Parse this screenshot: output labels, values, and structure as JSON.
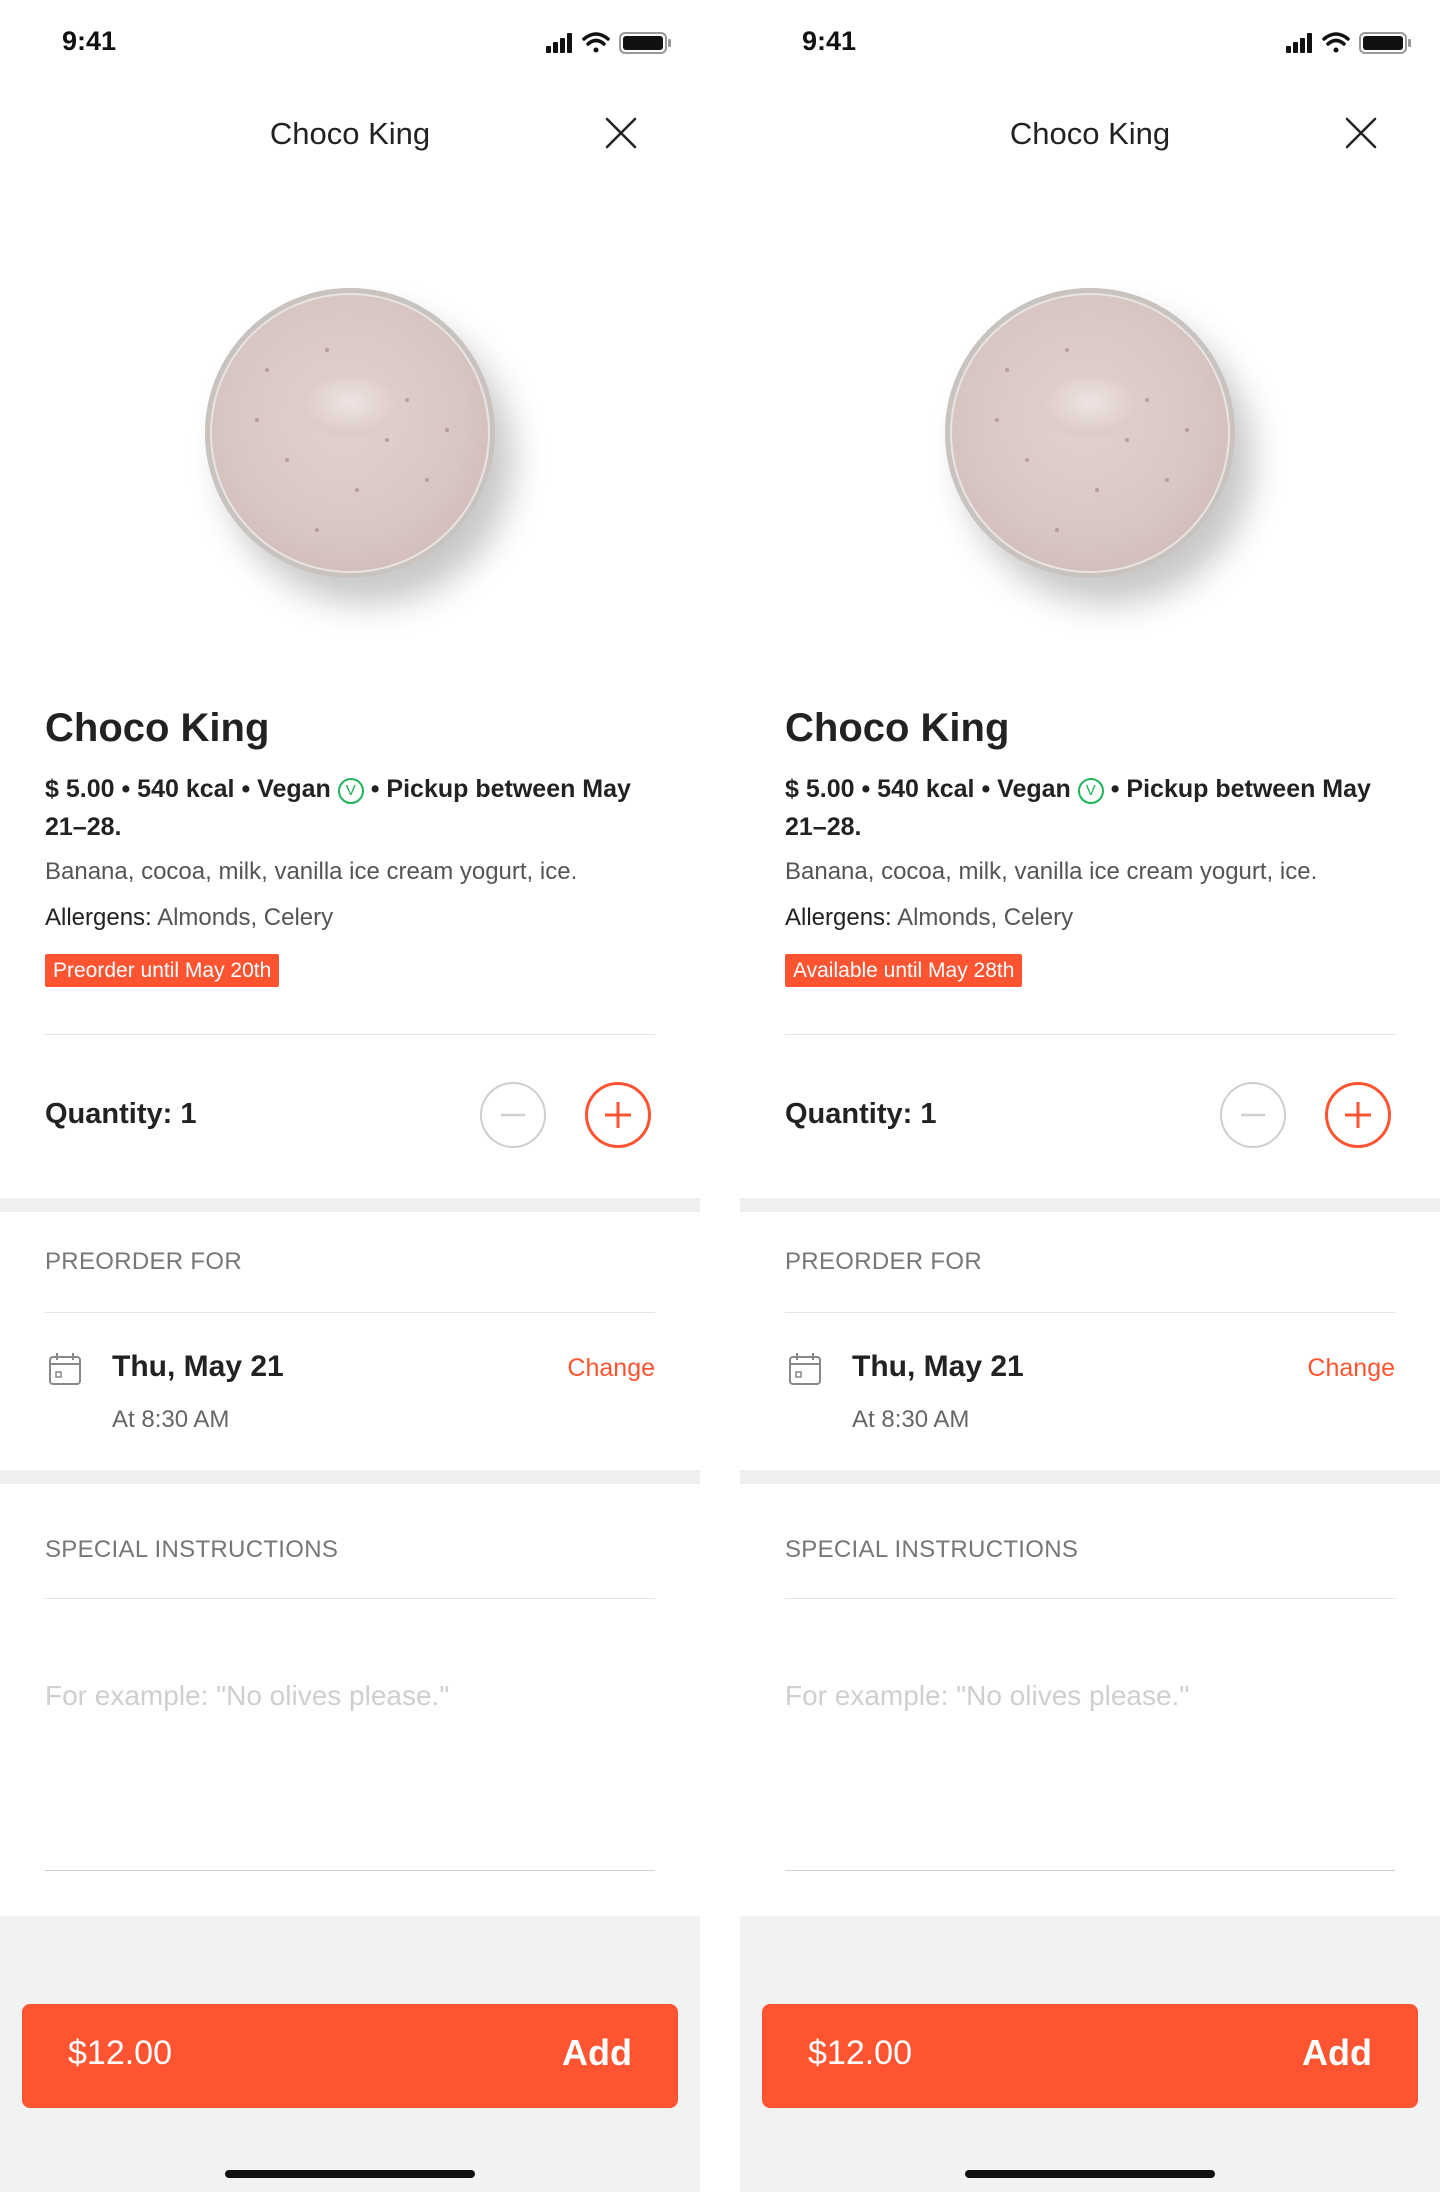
{
  "screens": [
    {
      "status": {
        "time": "9:41"
      },
      "header": {
        "title": "Choco King"
      },
      "product": {
        "name": "Choco King",
        "price": "$ 5.00",
        "kcal": "540 kcal",
        "diet": "Vegan",
        "vegan_symbol": "V",
        "pickup": "Pickup between May 21–28.",
        "ingredients": "Banana, cocoa, milk, vanilla ice cream yogurt, ice.",
        "allergens_label": "Allergens:",
        "allergens_value": "Almonds, Celery",
        "badge": "Preorder until May 20th"
      },
      "quantity": {
        "label": "Quantity: 1"
      },
      "preorder": {
        "heading": "PREORDER FOR",
        "date": "Thu, May 21",
        "time": "At 8:30 AM",
        "change": "Change"
      },
      "instructions": {
        "heading": "SPECIAL INSTRUCTIONS",
        "placeholder": "For example: \"No olives please.\""
      },
      "footer": {
        "price": "$12.00",
        "add": "Add"
      }
    },
    {
      "status": {
        "time": "9:41"
      },
      "header": {
        "title": "Choco King"
      },
      "product": {
        "name": "Choco King",
        "price": "$ 5.00",
        "kcal": "540 kcal",
        "diet": "Vegan",
        "vegan_symbol": "V",
        "pickup": "Pickup between May 21–28.",
        "ingredients": "Banana, cocoa, milk, vanilla ice cream yogurt, ice.",
        "allergens_label": "Allergens:",
        "allergens_value": "Almonds, Celery",
        "badge": "Available until May 28th"
      },
      "quantity": {
        "label": "Quantity: 1"
      },
      "preorder": {
        "heading": "PREORDER FOR",
        "date": "Thu, May 21",
        "time": "At 8:30 AM",
        "change": "Change"
      },
      "instructions": {
        "heading": "SPECIAL INSTRUCTIONS",
        "placeholder": "For example: \"No olives please.\""
      },
      "footer": {
        "price": "$12.00",
        "add": "Add"
      }
    }
  ],
  "colors": {
    "accent": "#fe5431",
    "vegan": "#1db45a",
    "section_gap": "#efefef"
  },
  "icons": [
    "signal-icon",
    "wifi-icon",
    "battery-icon",
    "close-icon",
    "minus-icon",
    "plus-icon",
    "calendar-icon"
  ]
}
